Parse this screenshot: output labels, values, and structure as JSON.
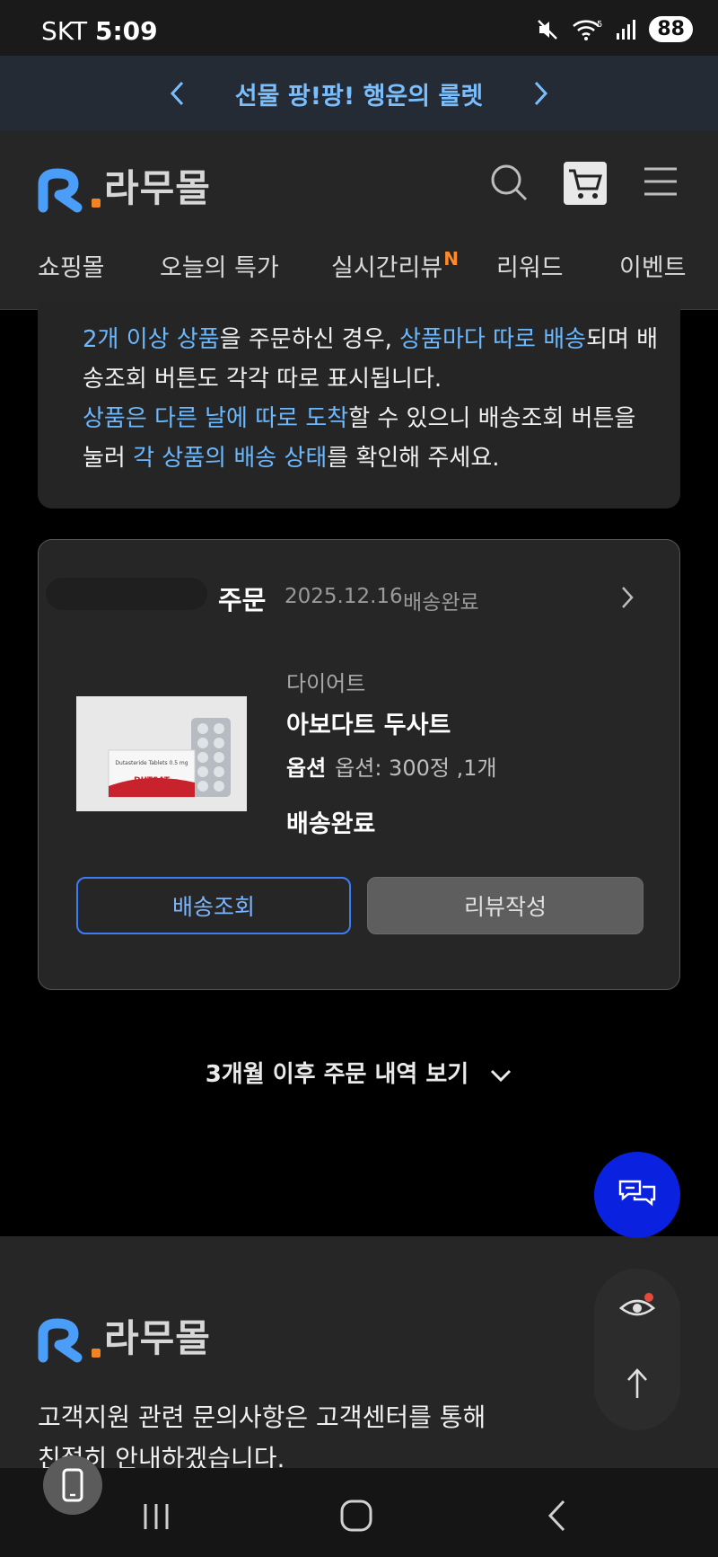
{
  "status_bar": {
    "carrier": "SKT",
    "time": "5:09",
    "battery": "88",
    "network": "5"
  },
  "promo": {
    "text": "선물 팡!팡! 행운의 룰렛"
  },
  "header": {
    "logo_text": "라무몰",
    "nav": [
      {
        "label": "쇼핑몰"
      },
      {
        "label": "오늘의 특가"
      },
      {
        "label": "실시간리뷰",
        "badge": "N"
      },
      {
        "label": "리워드"
      },
      {
        "label": "이벤트"
      }
    ]
  },
  "notice": {
    "l1a": "2개 이상 상품",
    "l1b": "을 주문하신 경우, ",
    "l1c": "상품마다 따로 배송",
    "l1d": "되며 배",
    "l2": "송조회 버튼도 각각 따로 표시됩니다.",
    "l3a": "상품은 다른 날에 따로 도착",
    "l3b": "할 수 있으니 배송조회 버튼을",
    "l4a": "눌러 ",
    "l4b": "각 상품의 배송 상태",
    "l4c": "를 확인해 주세요."
  },
  "order": {
    "label": "주문",
    "date": "2025.12.16",
    "status": "배송완료",
    "item": {
      "category": "다이어트",
      "name": "아보다트 두사트",
      "option_key": "옵션",
      "option_value": "옵션: 300정 ,1개",
      "delivery_status": "배송완료",
      "image_label": "DUTSAT",
      "image_subtitle": "Dutasteride Tablets 0.5 mg"
    },
    "buttons": {
      "track": "배송조회",
      "review": "리뷰작성"
    }
  },
  "more_orders": "3개월 이후 주문 내역 보기",
  "footer": {
    "logo_text": "라무몰",
    "support_line1": "고객지원 관련 문의사항은 고객센터를 통해",
    "support_line2": "친절히 안내하겠습니다."
  },
  "colors": {
    "accent_blue": "#6cb8ff",
    "chat_button": "#0a22e0",
    "logo_blue": "#4a9df8",
    "logo_orange": "#f58220",
    "badge_orange": "#ff8a2a"
  }
}
